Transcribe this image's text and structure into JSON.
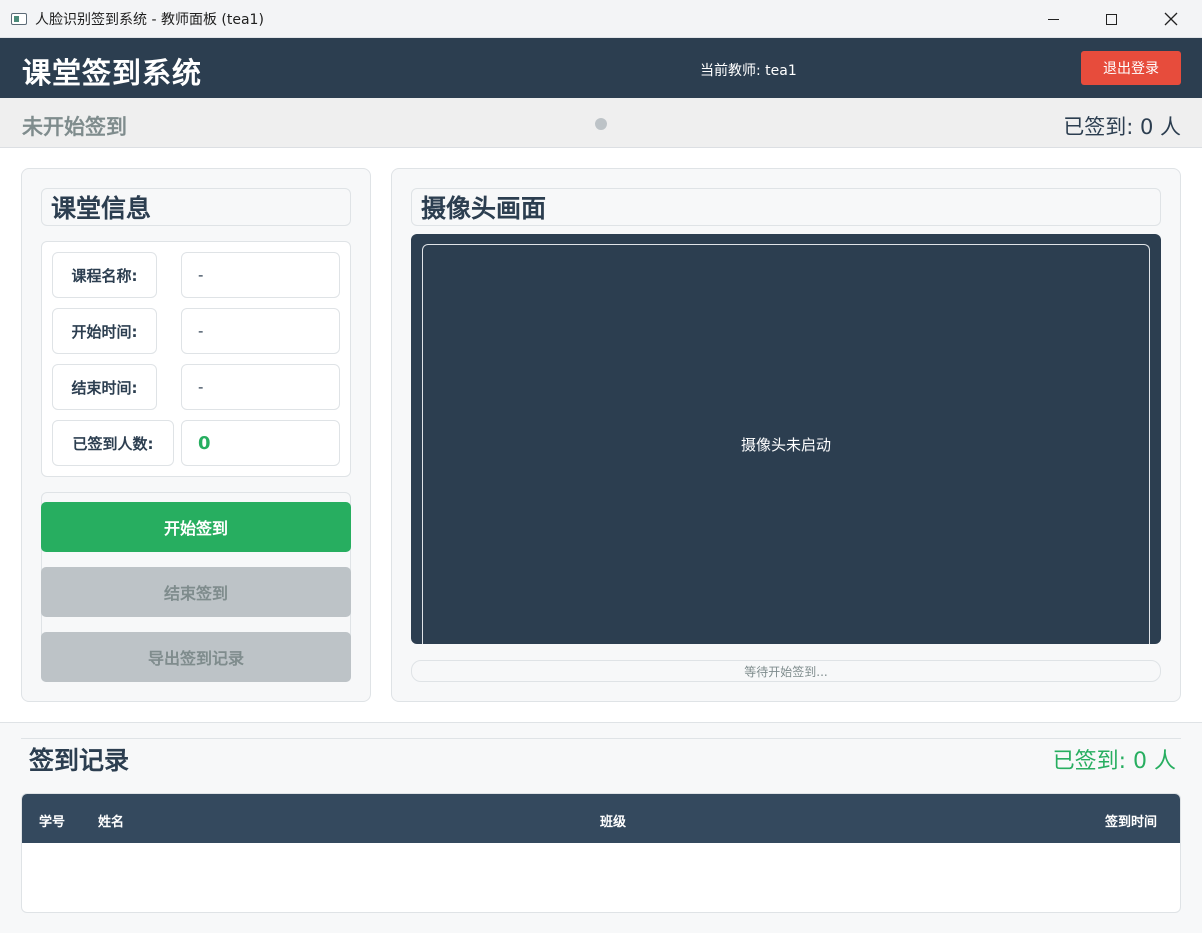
{
  "window": {
    "title": "人脸识别签到系统 - 教师面板 (tea1)"
  },
  "header": {
    "brand": "课堂签到系统",
    "teacher": "当前教师: tea1",
    "logout_label": "退出登录"
  },
  "status": {
    "state": "未开始签到",
    "checked_in": "已签到: 0 人"
  },
  "class_info": {
    "title": "课堂信息",
    "fields": [
      {
        "label": "课程名称:",
        "value": "-"
      },
      {
        "label": "开始时间:",
        "value": "-"
      },
      {
        "label": "结束时间:",
        "value": "-"
      },
      {
        "label": "已签到人数:",
        "value": "0"
      }
    ],
    "buttons": {
      "start": "开始签到",
      "end": "结束签到",
      "export": "导出签到记录"
    }
  },
  "camera": {
    "title": "摄像头画面",
    "placeholder": "摄像头未启动",
    "status": "等待开始签到..."
  },
  "records": {
    "title": "签到记录",
    "count": "已签到: 0 人",
    "columns": [
      "学号",
      "姓名",
      "班级",
      "签到时间"
    ],
    "rows": []
  },
  "colors": {
    "header_bg": "#2c3e50",
    "accent_green": "#27ae60",
    "logout_red": "#e74c3c",
    "disabled_gray": "#bdc3c7"
  }
}
